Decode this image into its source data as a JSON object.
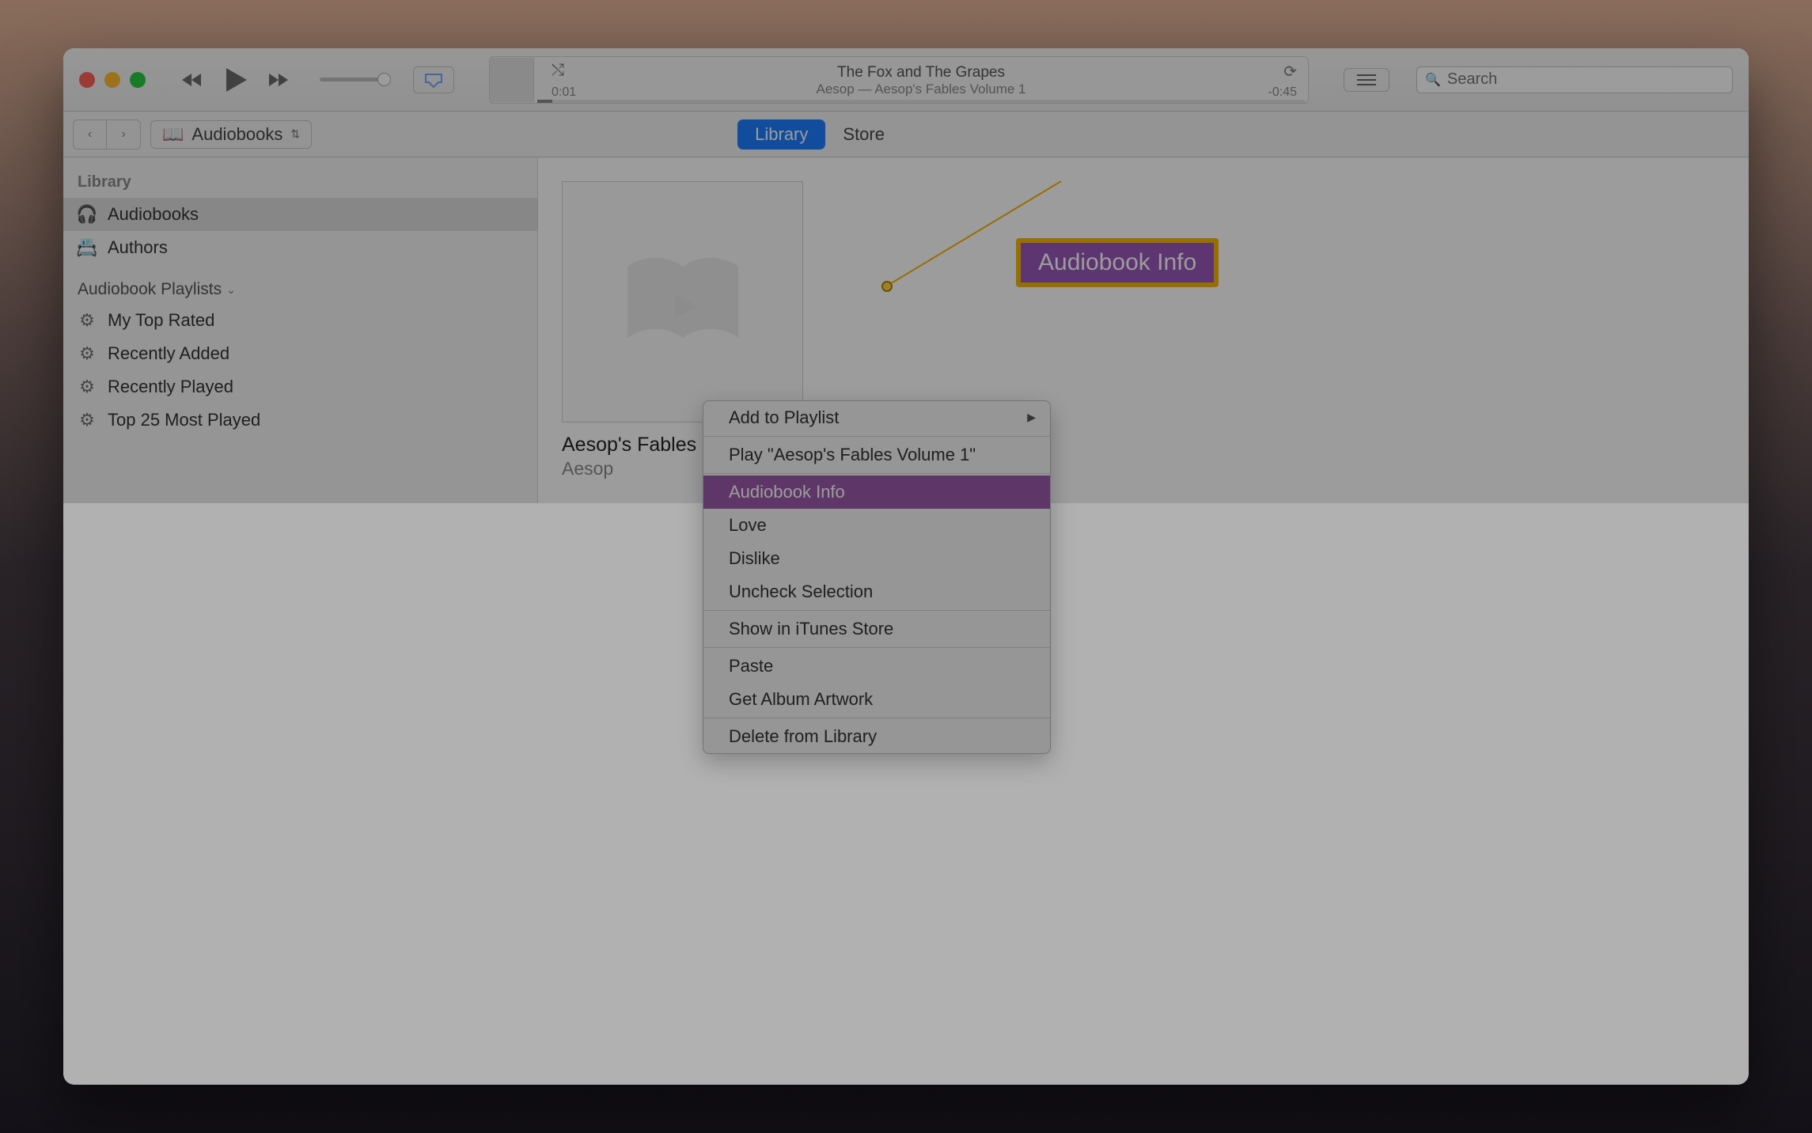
{
  "nowplaying": {
    "title": "The Fox and The Grapes",
    "subtitle": "Aesop — Aesop's Fables Volume 1",
    "elapsed": "0:01",
    "remaining": "-0:45"
  },
  "search": {
    "placeholder": "Search"
  },
  "category": "Audiobooks",
  "tabs": {
    "library": "Library",
    "store": "Store"
  },
  "sidebar": {
    "header1": "Library",
    "items": [
      "Audiobooks",
      "Authors"
    ],
    "header2": "Audiobook Playlists",
    "playlists": [
      "My Top Rated",
      "Recently Added",
      "Recently Played",
      "Top 25 Most Played"
    ]
  },
  "book": {
    "title": "Aesop's Fables",
    "author": "Aesop"
  },
  "ctx": {
    "add": "Add to Playlist",
    "play": "Play \"Aesop's Fables Volume 1\"",
    "info": "Audiobook Info",
    "love": "Love",
    "dislike": "Dislike",
    "uncheck": "Uncheck Selection",
    "show": "Show in iTunes Store",
    "paste": "Paste",
    "art": "Get Album Artwork",
    "delete": "Delete from Library"
  },
  "callout": "Audiobook Info"
}
